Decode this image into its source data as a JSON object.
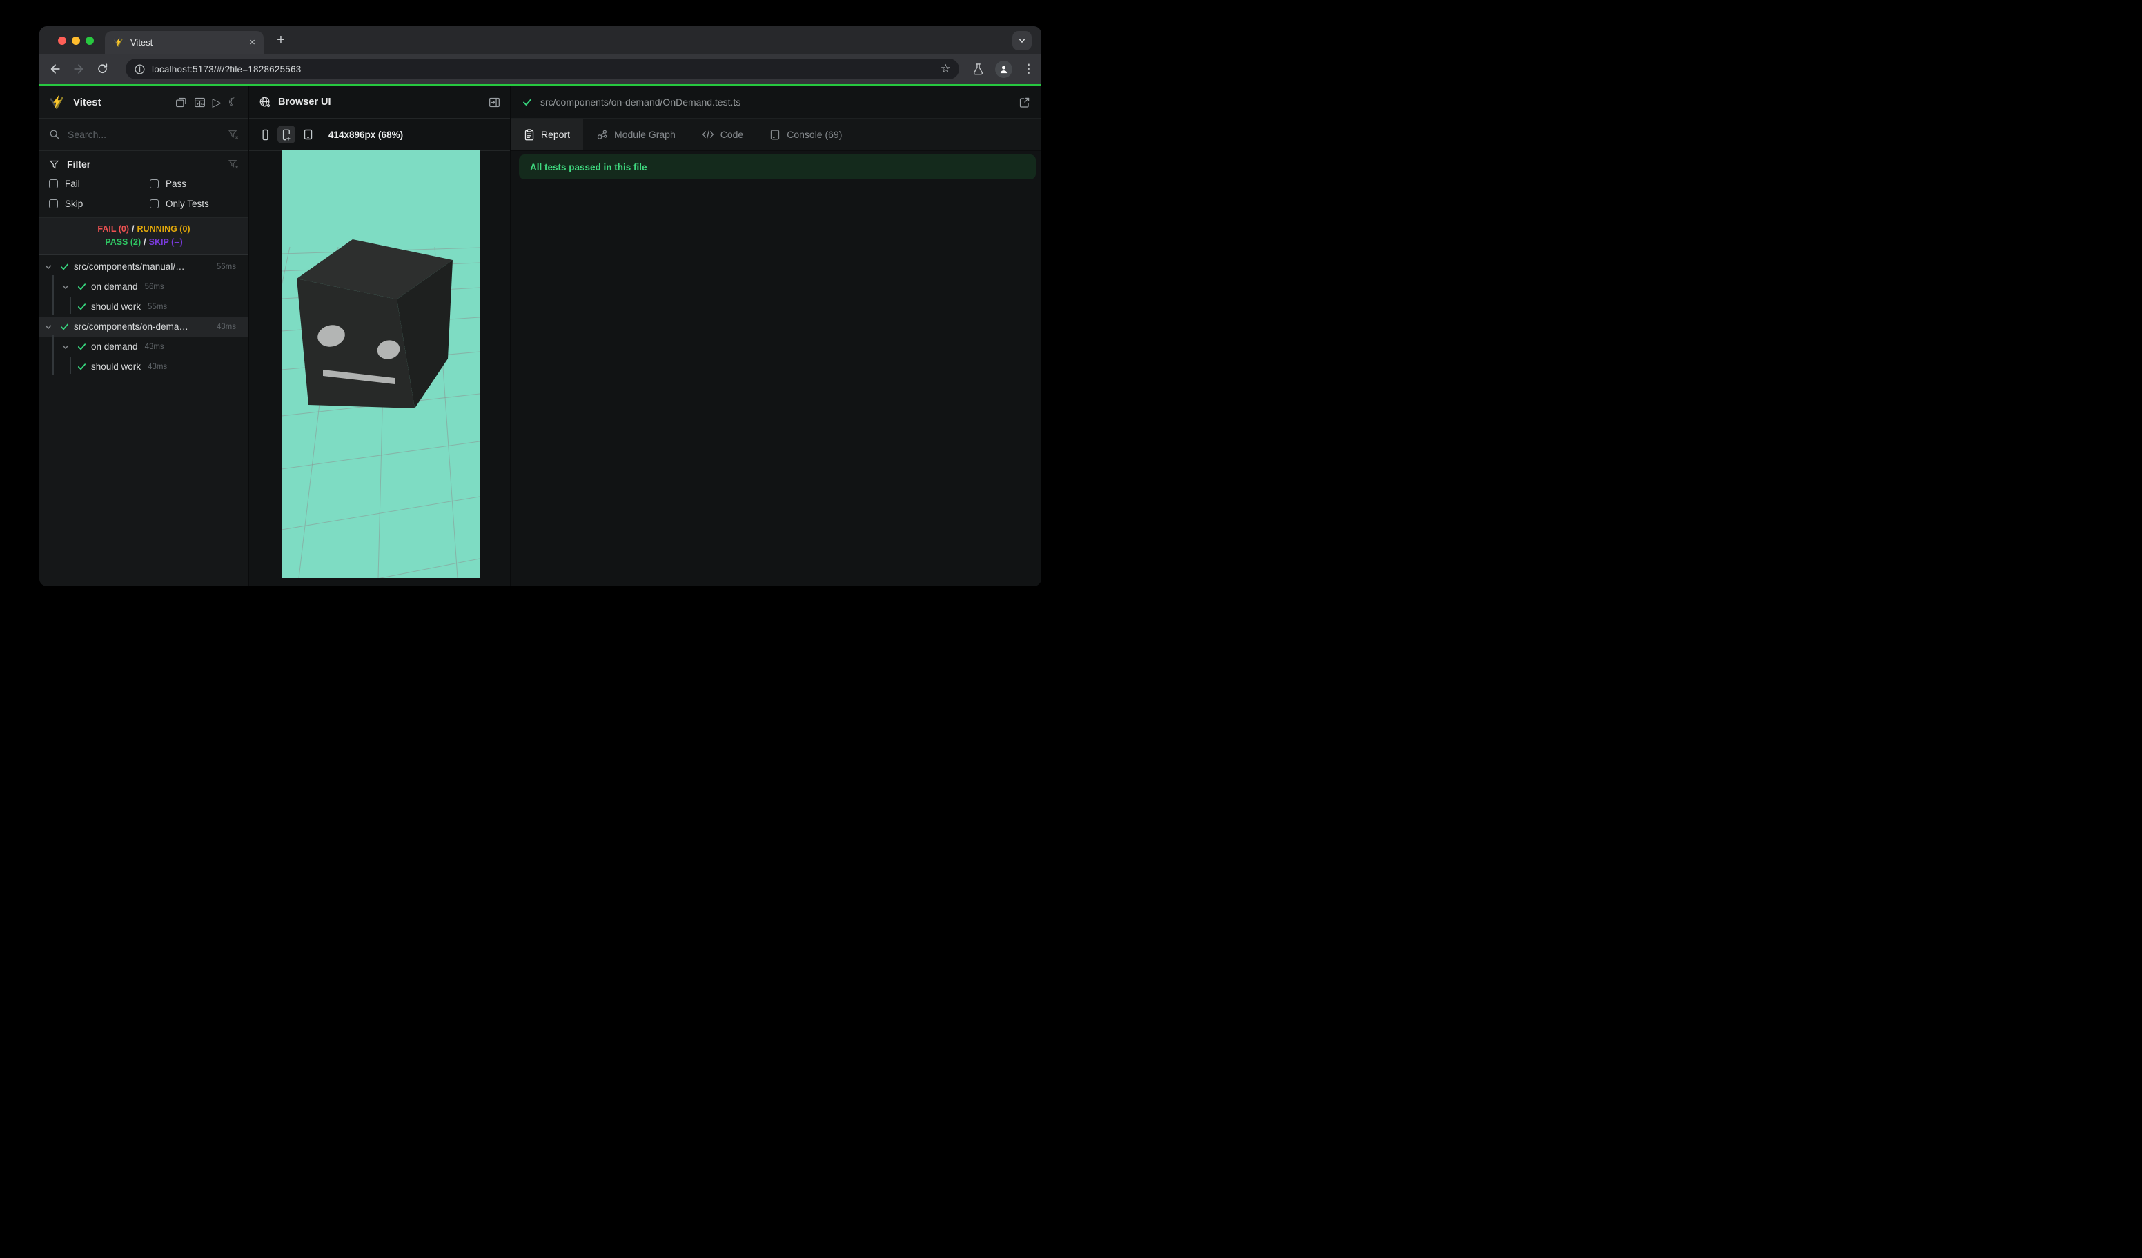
{
  "browser": {
    "tab_title": "Vitest",
    "url": "localhost:5173/#/?file=1828625563"
  },
  "glyphs": {
    "close": "×",
    "new_tab": "+",
    "star": "☆",
    "kebab": "⋮",
    "play": "▷",
    "moon": "☾"
  },
  "colors": {
    "progress_green": "#27c840",
    "check_green": "#36d27c",
    "banner_bg": "#142a1c",
    "banner_text": "#3fd97f",
    "fail_red": "#f05252",
    "running_yellow": "#e0a70a",
    "pass_green": "#2fc964",
    "skip_purple": "#7a3bdd",
    "viewport_teal": "#7edcc3"
  },
  "sidebar": {
    "title": "Vitest",
    "search_placeholder": "Search...",
    "filter_title": "Filter",
    "filters": [
      {
        "label": "Fail"
      },
      {
        "label": "Pass"
      },
      {
        "label": "Skip"
      },
      {
        "label": "Only Tests"
      }
    ],
    "status": {
      "fail": "FAIL (0)",
      "sep1": "/",
      "running": "RUNNING (0)",
      "pass": "PASS (2)",
      "sep2": "/",
      "skip": "SKIP (--)"
    },
    "tree": [
      {
        "label": "src/components/manual/…",
        "duration": "56ms",
        "level": 0
      },
      {
        "label": "on demand",
        "duration": "56ms",
        "level": 1
      },
      {
        "label": "should work",
        "duration": "55ms",
        "level": 2
      },
      {
        "label": "src/components/on-dema…",
        "duration": "43ms",
        "level": 0,
        "selected": true
      },
      {
        "label": "on demand",
        "duration": "43ms",
        "level": 1
      },
      {
        "label": "should work",
        "duration": "43ms",
        "level": 2
      }
    ]
  },
  "preview": {
    "title": "Browser UI",
    "dimensions": "414x896px (68%)"
  },
  "detail": {
    "file_path": "src/components/on-demand/OnDemand.test.ts",
    "tabs": [
      {
        "label": "Report"
      },
      {
        "label": "Module Graph"
      },
      {
        "label": "Code"
      },
      {
        "label": "Console (69)"
      }
    ],
    "banner": "All tests passed in this file"
  }
}
